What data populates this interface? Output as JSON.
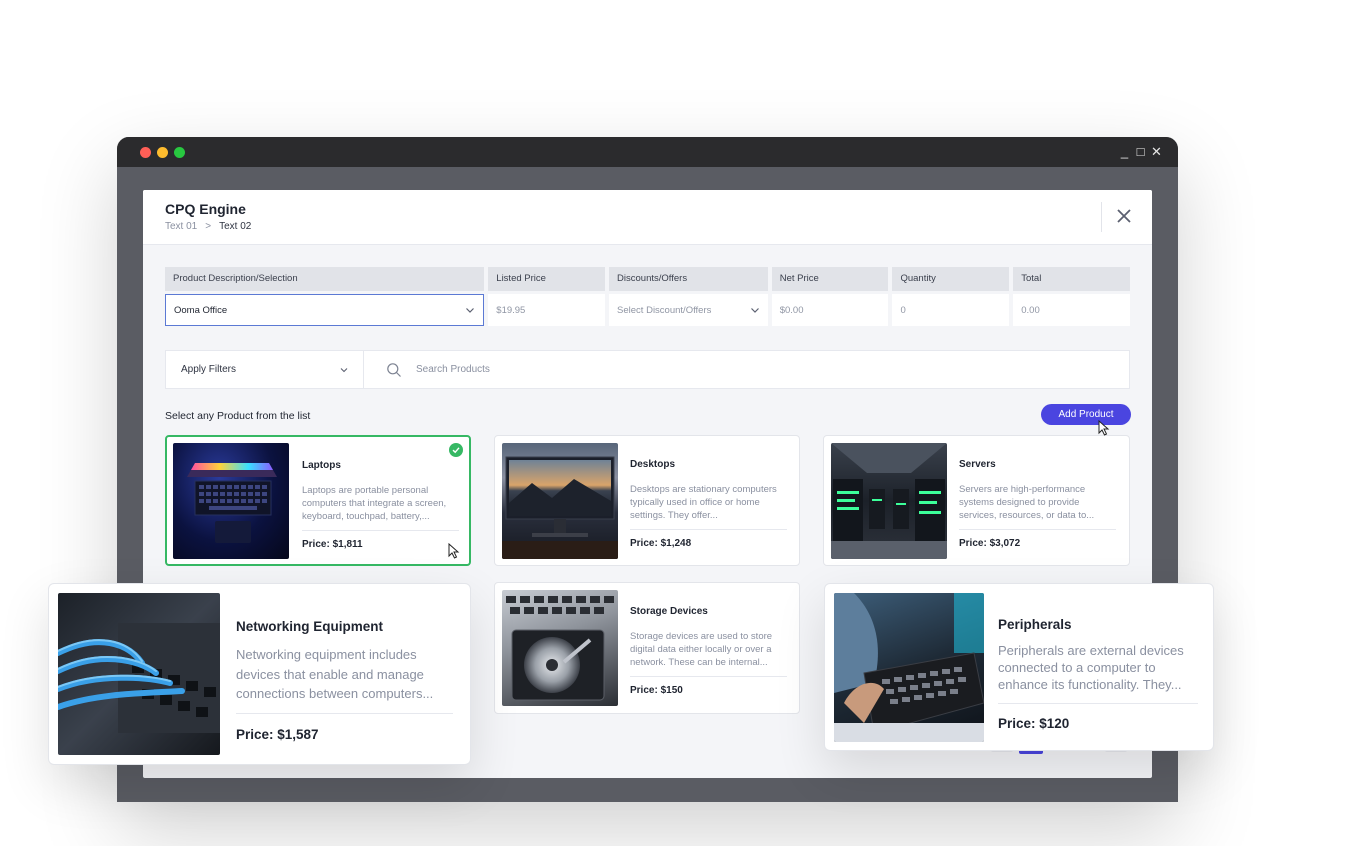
{
  "window": {
    "controls": [
      "_",
      "□",
      "✕"
    ]
  },
  "header": {
    "title": "CPQ Engine",
    "breadcrumb": {
      "first": "Text 01",
      "separator": ">",
      "current": "Text 02"
    }
  },
  "table": {
    "headers": [
      "Product Description/Selection",
      "Listed Price",
      "Discounts/Offers",
      "Net Price",
      "Quantity",
      "Total"
    ],
    "row": {
      "product": "Ooma Office",
      "listed_price": "$19.95",
      "discount_placeholder": "Select Discount/Offers",
      "net_price": "$0.00",
      "quantity": "0",
      "total": "0.00"
    }
  },
  "filters": {
    "label": "Apply Filters",
    "search_placeholder": "Search Products"
  },
  "section_label": "Select any Product from the list",
  "add_button": "Add Product",
  "products": [
    {
      "name": "Laptops",
      "desc": "Laptops are portable personal computers that integrate a screen, keyboard, touchpad, battery,...",
      "price": "Price: $1,811",
      "selected": true
    },
    {
      "name": "Desktops",
      "desc": "Desktops are stationary computers typically used in office or home settings. They offer...",
      "price": "Price: $1,248"
    },
    {
      "name": "Servers",
      "desc": "Servers are high-performance systems designed to provide services, resources, or data to...",
      "price": "Price: $3,072"
    },
    {
      "name": "Networking Equipment",
      "desc": "Networking equipment includes devices that enable and manage connections between computers...",
      "price": "Price: $1,587"
    },
    {
      "name": "Storage Devices",
      "desc": "Storage devices are used to store digital data either locally or over a network. These can be internal...",
      "price": "Price: $150"
    },
    {
      "name": "Peripherals",
      "desc": "Peripherals are external devices connected to a computer to enhance its functionality. They...",
      "price": "Price: $120"
    }
  ],
  "colors": {
    "accent": "#4a45e0",
    "selected": "#36b864",
    "close_red": "#ff5f57",
    "minimize_yellow": "#febc2e",
    "maximize_green": "#28c840"
  }
}
